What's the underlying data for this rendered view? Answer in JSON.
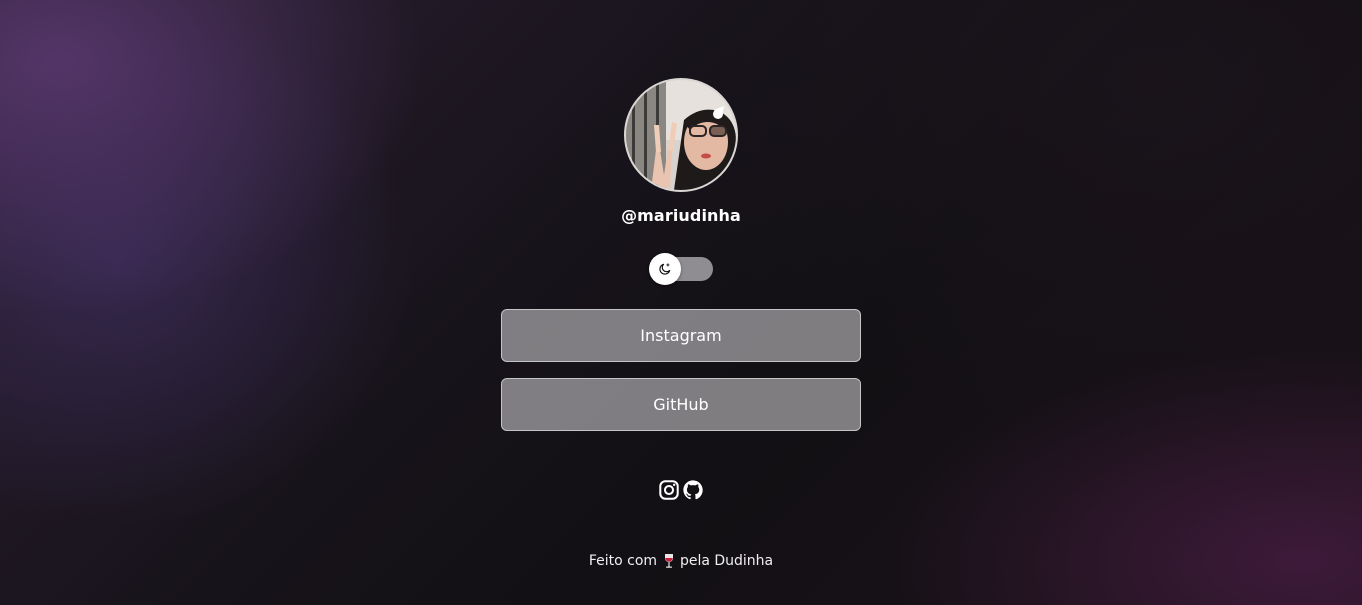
{
  "profile": {
    "username": "@mariudinha"
  },
  "theme_toggle": {
    "icon": "moon-icon",
    "state": "off"
  },
  "links": [
    {
      "label": "Instagram"
    },
    {
      "label": "GitHub"
    }
  ],
  "social_icons": [
    "instagram-icon",
    "github-icon"
  ],
  "footer": {
    "text_before": "Feito com",
    "icon": "wine-glass-icon",
    "text_after": "pela Dudinha"
  },
  "colors": {
    "background": "#141116",
    "button_fill": "#8d8b8f",
    "toggle_track": "#8f8d91",
    "text": "#ffffff"
  }
}
